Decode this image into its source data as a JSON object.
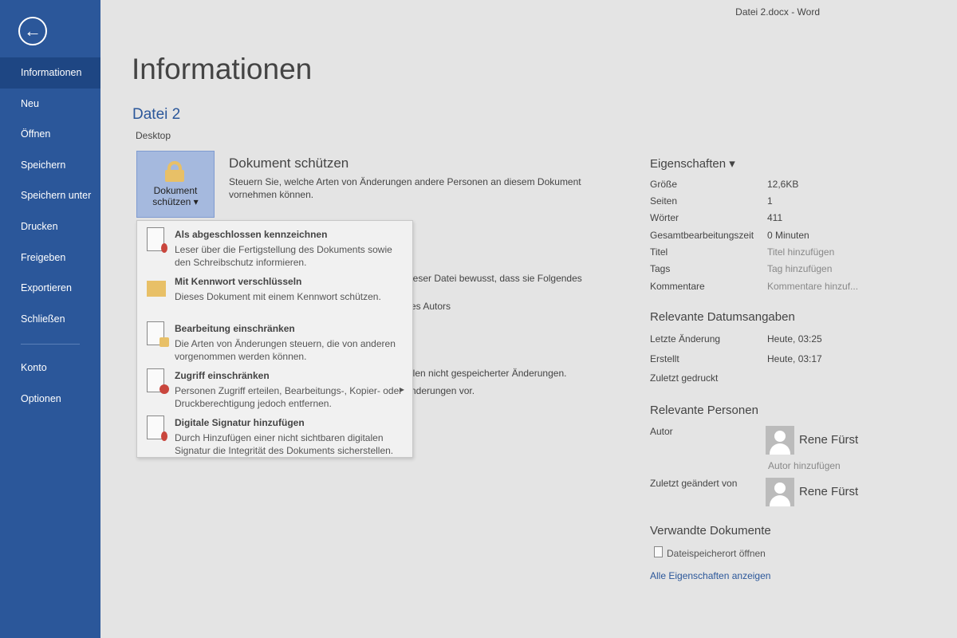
{
  "window_title": "Datei 2.docx - Word",
  "sidebar": {
    "back": "←",
    "items": [
      "Informationen",
      "Neu",
      "Öffnen",
      "Speichern",
      "Speichern unter",
      "Drucken",
      "Freigeben",
      "Exportieren",
      "Schließen"
    ],
    "items2": [
      "Konto",
      "Optionen"
    ]
  },
  "page_title": "Informationen",
  "file": {
    "name": "Datei 2",
    "location": "Desktop"
  },
  "protect": {
    "button_line1": "Dokument",
    "button_line2": "schützen ▾",
    "title": "Dokument schützen",
    "desc": "Steuern Sie, welche Arten von Änderungen andere Personen an diesem Dokument vornehmen können."
  },
  "background_fragments": [
    "ieser Datei bewusst, dass sie Folgendes",
    "es Autors",
    "llen nicht gespeicherter Änderungen.",
    "nderungen vor."
  ],
  "menu": [
    {
      "title": "Als abgeschlossen kennzeichnen",
      "desc": "Leser über die Fertigstellung des Dokuments sowie den Schreibschutz informieren."
    },
    {
      "title": "Mit Kennwort verschlüsseln",
      "desc": "Dieses Dokument mit einem Kennwort schützen."
    },
    {
      "title": "Bearbeitung einschränken",
      "desc": "Die Arten von Änderungen steuern, die von anderen vorgenommen werden können."
    },
    {
      "title": "Zugriff einschränken",
      "desc": "Personen Zugriff erteilen, Bearbeitungs-, Kopier- oder Druckberechtigung jedoch entfernen."
    },
    {
      "title": "Digitale Signatur hinzufügen",
      "desc": "Durch Hinzufügen einer nicht sichtbaren digitalen Signatur die Integrität des Dokuments sicherstellen."
    }
  ],
  "properties": {
    "heading": "Eigenschaften ▾",
    "rows": [
      [
        "Größe",
        "12,6KB"
      ],
      [
        "Seiten",
        "1"
      ],
      [
        "Wörter",
        "411"
      ],
      [
        "Gesamtbearbeitungszeit",
        "0 Minuten"
      ],
      [
        "Titel",
        "Titel hinzufügen"
      ],
      [
        "Tags",
        "Tag hinzufügen"
      ],
      [
        "Kommentare",
        "Kommentare hinzuf..."
      ]
    ]
  },
  "dates": {
    "heading": "Relevante Datumsangaben",
    "rows": [
      [
        "Letzte Änderung",
        "Heute, 03:25"
      ],
      [
        "Erstellt",
        "Heute, 03:17"
      ],
      [
        "Zuletzt gedruckt",
        ""
      ]
    ]
  },
  "people": {
    "heading": "Relevante Personen",
    "author_label": "Autor",
    "author": "Rene Fürst",
    "add_author": "Autor hinzufügen",
    "modified_label": "Zuletzt geändert von",
    "modified_by": "Rene Fürst"
  },
  "related": {
    "heading": "Verwandte Dokumente",
    "open_location": "Dateispeicherort öffnen",
    "show_all": "Alle Eigenschaften anzeigen"
  },
  "colors": {
    "sidebar": "#2b579a",
    "accent": "#2b579a"
  }
}
